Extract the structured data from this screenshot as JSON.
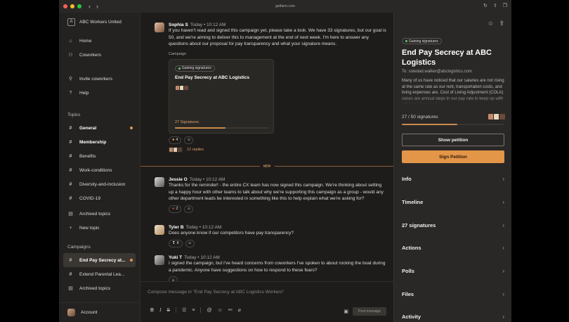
{
  "browser": {
    "url": "getfarm.com",
    "nav_back": "‹",
    "nav_forward": "›"
  },
  "sidebar": {
    "workspace_initial": "A",
    "workspace_name": "ABC Workers United",
    "nav": [
      {
        "label": "Home",
        "icon": "home-icon"
      },
      {
        "label": "Coworkers",
        "icon": "people-icon"
      },
      {
        "label": "Invite coworkers",
        "icon": "add-user-icon"
      },
      {
        "label": "Help",
        "icon": "help-icon"
      }
    ],
    "topics_label": "Topics",
    "topics": [
      {
        "label": "General",
        "bold": true,
        "unread": true
      },
      {
        "label": "Membership",
        "bold": true,
        "unread": false
      },
      {
        "label": "Benefits",
        "bold": false,
        "unread": false
      },
      {
        "label": "Work-conditions",
        "bold": false,
        "unread": false
      },
      {
        "label": "Diversity-and-inclusion",
        "bold": false,
        "unread": false
      },
      {
        "label": "COVID-19",
        "bold": false,
        "unread": false
      }
    ],
    "archived_topics": "Archived topics",
    "new_topic": "New topic",
    "campaigns_label": "Campaigns",
    "campaigns": [
      {
        "label": "End Pay Secrecy at...",
        "active": true,
        "unread": true
      },
      {
        "label": "Extend Parental Lea...",
        "active": false,
        "unread": false
      }
    ],
    "archived_campaigns": "Archived topics",
    "account": "Account"
  },
  "messages": {
    "m1": {
      "author": "Sophia S",
      "time": "Today • 10:12 AM",
      "text": "If you haven't read and signed this campaign yet, please take a look. We have 33 signatures, but our goal is 50, and we're aiming to deliver this to management at the end of next week. I'm here to answer any questions about our proposal for pay transparency and what your signature means.",
      "campaign_label": "Campaign",
      "card_chip": "Gaining signatures",
      "card_title": "End Pay Secrecy at ABC Logistics",
      "card_signatures": "27 Signatures",
      "card_progress": 0.54,
      "reaction_count": "4",
      "replies": "12 replies"
    },
    "new_label": "NEW",
    "m2": {
      "author": "Jessie O",
      "time": "Today • 10:12 AM",
      "text": "Thanks for the reminder! - the entire CX team has now signed this campaign. We're thinking about setting up a happy hour with other teams to talk about why we're supporting this campaign as a group - would any other department leads be interested in something like this to help explain what we're asking for?",
      "reaction_count": "2"
    },
    "m3": {
      "author": "Tyler B",
      "time": "Today • 10:12 AM",
      "text": "Does anyone know if our competitors have pay transparency?",
      "reaction_count": "8"
    },
    "m4": {
      "author": "Yuki T",
      "time": "Today • 10:12 AM",
      "text": "I signed the campaign, but I've heard concerns from coworkers I've spoken to about rocking the boat during a pandemic. Anyone have suggestions on how to respond to these fears?"
    }
  },
  "composer": {
    "placeholder": "Compose message in \"End Pay Secrecy at ABC Logistics Workers\"",
    "post_label": "Post message"
  },
  "panel": {
    "chip": "Gaining signatures",
    "title": "End Pay Secrecy at ABC Logistics",
    "to": "To: soledad.walker@abclogistics.com",
    "description": "Many of us have noticed that our salaries are not rising at the same rate as our rent, transportation costs, and living expenses are. Cost of Living Adjustment (COLA) raises are annual steps in our pay rate to keep up with inflation. More sadly...",
    "signatures": "27 / 50 signatures",
    "signature_progress": 0.54,
    "show_petition": "Show petition",
    "sign_petition": "Sign Petition",
    "sections": [
      "Info",
      "Timeline",
      "27 signatures",
      "Actions",
      "Polls",
      "Files",
      "Activity"
    ]
  },
  "colors": {
    "accent": "#e39548",
    "chip_dot": "#5dcf7a"
  }
}
